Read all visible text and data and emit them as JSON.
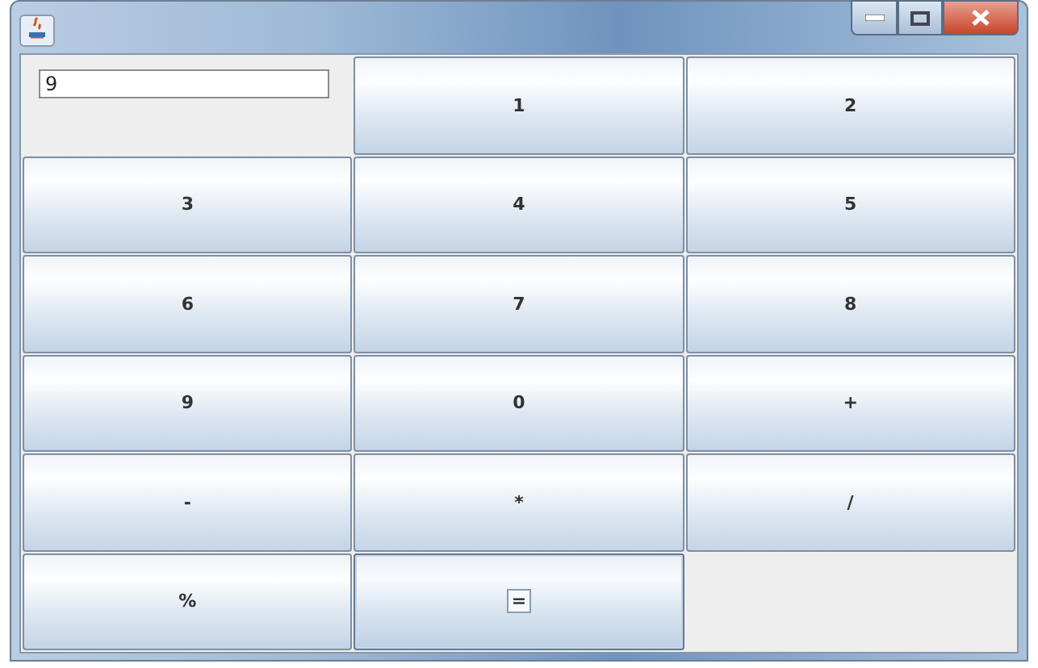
{
  "window": {
    "controls": [
      {
        "kind": "minimize"
      },
      {
        "kind": "maximize"
      },
      {
        "kind": "close"
      }
    ]
  },
  "display": {
    "value": "9"
  },
  "buttons": [
    {
      "label": "1",
      "focused": false
    },
    {
      "label": "2",
      "focused": false
    },
    {
      "label": "3",
      "focused": false
    },
    {
      "label": "4",
      "focused": false
    },
    {
      "label": "5",
      "focused": false
    },
    {
      "label": "6",
      "focused": false
    },
    {
      "label": "7",
      "focused": false
    },
    {
      "label": "8",
      "focused": false
    },
    {
      "label": "9",
      "focused": false
    },
    {
      "label": "0",
      "focused": false
    },
    {
      "label": "+",
      "focused": false
    },
    {
      "label": "-",
      "focused": false
    },
    {
      "label": "*",
      "focused": false
    },
    {
      "label": "/",
      "focused": false
    },
    {
      "label": "%",
      "focused": false
    },
    {
      "label": "=",
      "focused": true
    }
  ]
}
